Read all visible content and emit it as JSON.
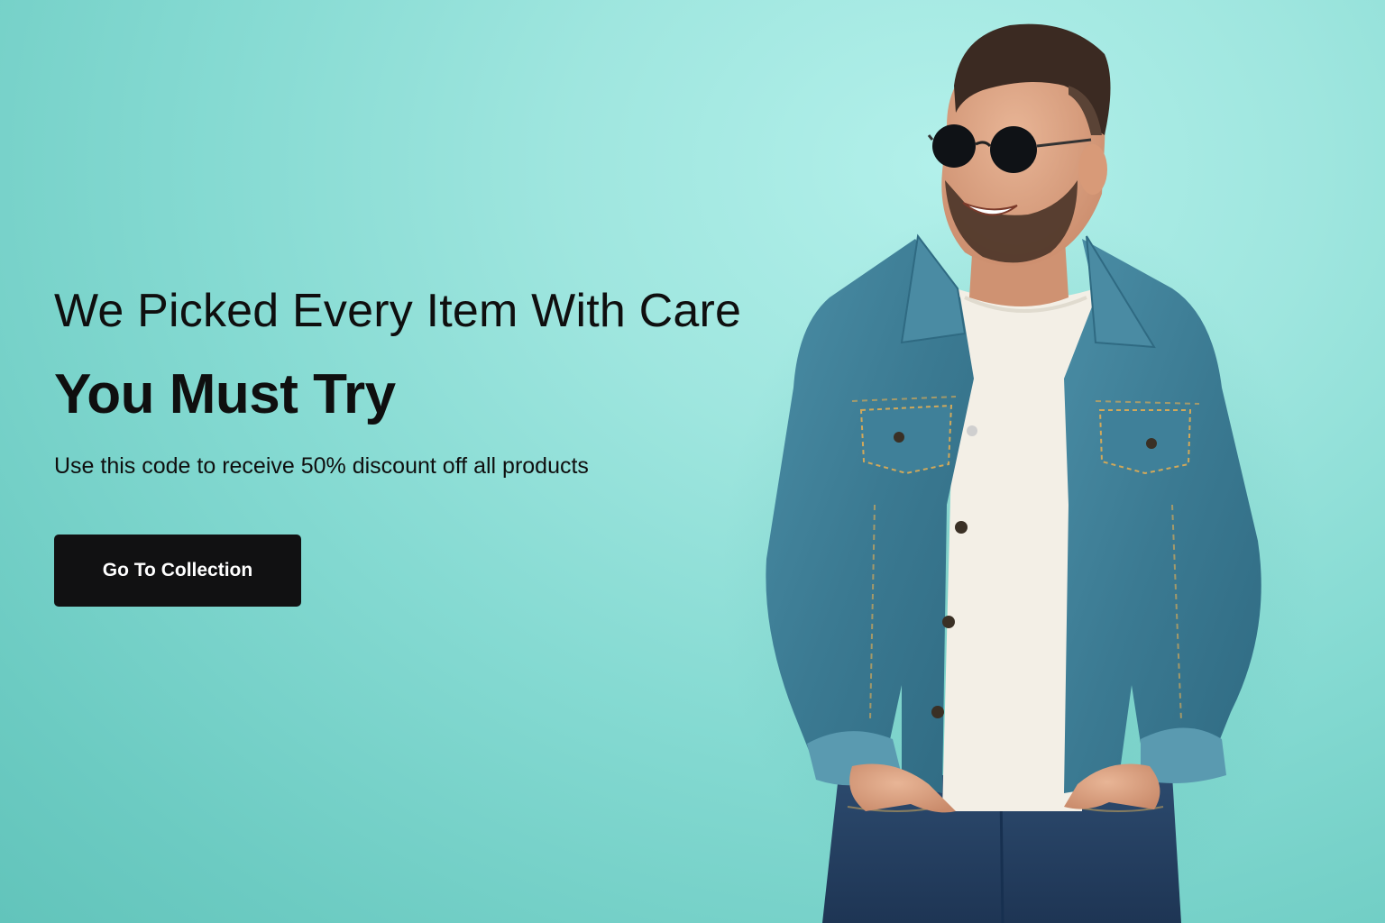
{
  "hero": {
    "headline": "We Picked Every Item With Care",
    "subhead": "You Must Try",
    "tagline": "Use this code to receive 50% discount off all products",
    "cta_label": "Go To Collection"
  },
  "colors": {
    "background": "#8fded6",
    "button_bg": "#111112",
    "button_text": "#ffffff",
    "text": "#0f0f0f",
    "denim": "#3e7f98",
    "tshirt": "#f3efe6"
  },
  "image": {
    "icon": "smiling-man-in-denim-jacket-photo"
  }
}
